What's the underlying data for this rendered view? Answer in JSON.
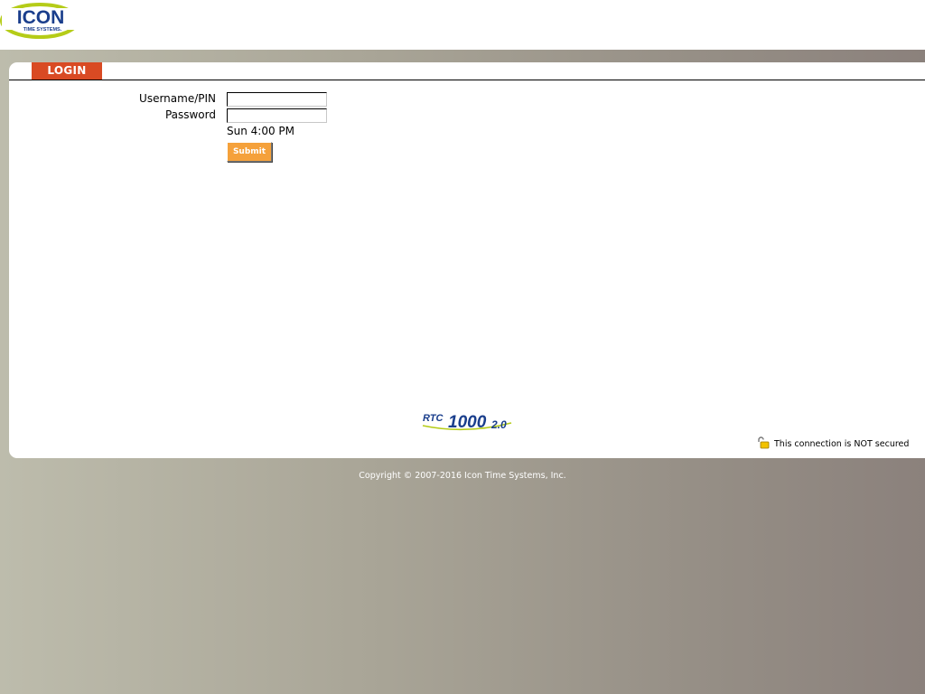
{
  "brand": {
    "name": "ICON",
    "tagline": "TIME SYSTEMS."
  },
  "login": {
    "tab_label": "LOGIN",
    "username_label": "Username/PIN",
    "password_label": "Password",
    "username_value": "",
    "password_value": "",
    "time": "Sun 4:00 PM",
    "submit_label": "Submit"
  },
  "product": {
    "prefix": "RTC",
    "model": "1000",
    "version": "2.0"
  },
  "security": {
    "text": "This connection is NOT secured"
  },
  "footer": {
    "copyright": "Copyright © 2007-2016 Icon Time Systems, Inc."
  },
  "colors": {
    "tab": "#d94a23",
    "submit": "#f5a13b",
    "logo_blue": "#1a3e8c",
    "logo_green": "#b5cc18"
  }
}
